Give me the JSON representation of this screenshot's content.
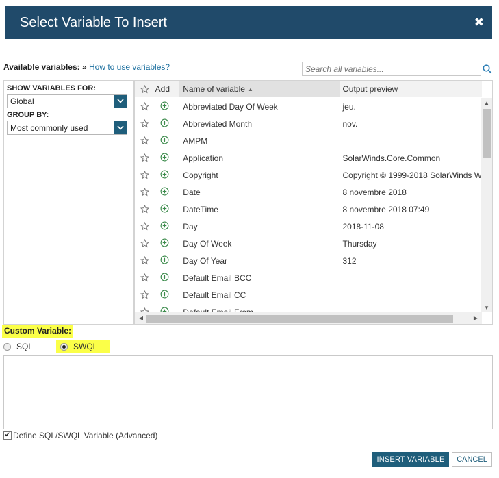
{
  "dialog": {
    "title": "Select Variable To Insert",
    "close_glyph": "✖"
  },
  "available": {
    "label": "Available variables:",
    "separator": "»",
    "help_link": "How to use variables?"
  },
  "search": {
    "placeholder": "Search all variables..."
  },
  "filters": {
    "show_label": "SHOW VARIABLES FOR:",
    "show_value": "Global",
    "group_label": "GROUP BY:",
    "group_value": "Most commonly used"
  },
  "grid": {
    "columns": {
      "add": "Add",
      "name": "Name of variable",
      "output": "Output preview"
    },
    "rows": [
      {
        "name": "Abbreviated Day Of Week",
        "output": "jeu."
      },
      {
        "name": "Abbreviated Month",
        "output": "nov."
      },
      {
        "name": "AMPM",
        "output": ""
      },
      {
        "name": "Application",
        "output": "SolarWinds.Core.Common"
      },
      {
        "name": "Copyright",
        "output": "Copyright © 1999-2018 SolarWinds W"
      },
      {
        "name": "Date",
        "output": "8 novembre 2018"
      },
      {
        "name": "DateTime",
        "output": "8 novembre 2018 07:49"
      },
      {
        "name": "Day",
        "output": "2018-11-08"
      },
      {
        "name": "Day Of Week",
        "output": "Thursday"
      },
      {
        "name": "Day Of Year",
        "output": "312"
      },
      {
        "name": "Default Email BCC",
        "output": ""
      },
      {
        "name": "Default Email CC",
        "output": ""
      },
      {
        "name": "Default Email From",
        "output": ""
      }
    ]
  },
  "custom": {
    "label": "Custom Variable:",
    "sql": "SQL",
    "swql": "SWQL",
    "selected": "SWQL",
    "query_value": ""
  },
  "advanced": {
    "label": "Define SQL/SWQL Variable (Advanced)",
    "checked": true
  },
  "buttons": {
    "insert": "INSERT VARIABLE",
    "cancel": "CANCEL"
  },
  "colors": {
    "header": "#204a6a",
    "accent": "#1f5e7b",
    "highlight": "#fbff48",
    "link": "#1a6e9e"
  },
  "icons": {
    "star": "star-outline-icon",
    "add": "plus-circle-icon",
    "search": "magnifier-icon"
  }
}
